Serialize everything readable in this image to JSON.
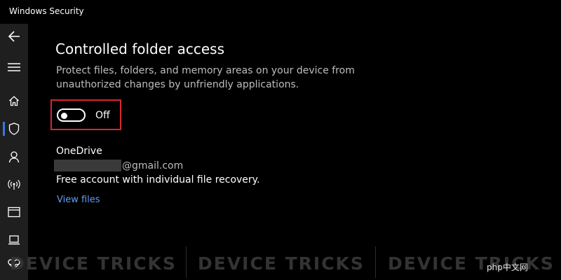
{
  "window": {
    "title": "Windows Security"
  },
  "nav": {
    "items": [
      {
        "name": "back-icon"
      },
      {
        "name": "menu-icon"
      },
      {
        "name": "home-icon"
      },
      {
        "name": "shield-icon"
      },
      {
        "name": "account-icon"
      },
      {
        "name": "wireless-icon"
      },
      {
        "name": "app-browser-icon"
      },
      {
        "name": "device-icon"
      },
      {
        "name": "health-icon"
      }
    ]
  },
  "page": {
    "title": "Controlled folder access",
    "description": "Protect files, folders, and memory areas on your device from unauthorized changes by unfriendly applications."
  },
  "toggle": {
    "state_label": "Off",
    "on": false
  },
  "onedrive": {
    "title": "OneDrive",
    "email_suffix": "@gmail.com",
    "description": "Free account with individual file recovery.",
    "view_files_label": "View files"
  },
  "watermark": {
    "text1": "DEVICE TRICKS",
    "text2": "DEVICE TRICKS",
    "text3": "DEVICE TRICKS",
    "brand": "php中文网"
  },
  "colors": {
    "accent": "#3b78d8",
    "highlight": "#d9272e",
    "link": "#5f9ff5"
  }
}
